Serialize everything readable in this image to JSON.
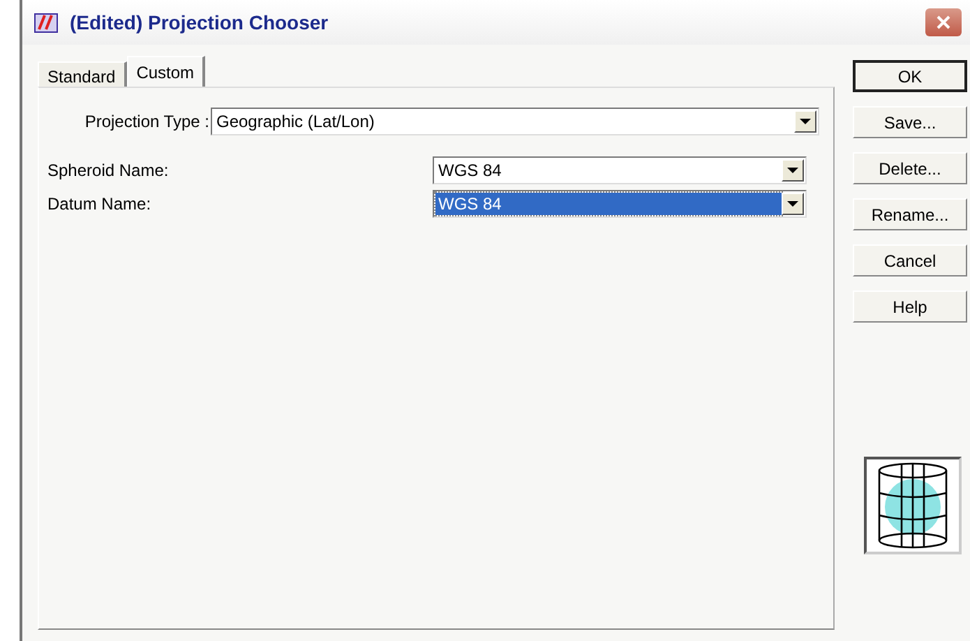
{
  "window": {
    "title": "(Edited) Projection Chooser"
  },
  "tabs": [
    {
      "label": "Standard",
      "selected": false
    },
    {
      "label": "Custom",
      "selected": true
    }
  ],
  "fields": [
    {
      "kind": "wide",
      "label": "Projection Type :",
      "value": "Geographic (Lat/Lon)",
      "selected": false
    },
    {
      "kind": "split",
      "label": "Spheroid Name:",
      "value": "WGS 84",
      "selected": false
    },
    {
      "kind": "split",
      "label": "Datum Name:",
      "value": "WGS 84",
      "selected": true
    }
  ],
  "buttons": [
    {
      "label": "OK",
      "default": true
    },
    {
      "label": "Save...",
      "default": false
    },
    {
      "label": "Delete...",
      "default": false
    },
    {
      "label": "Rename...",
      "default": false
    },
    {
      "label": "Cancel",
      "default": false
    },
    {
      "label": "Help",
      "default": false
    }
  ]
}
